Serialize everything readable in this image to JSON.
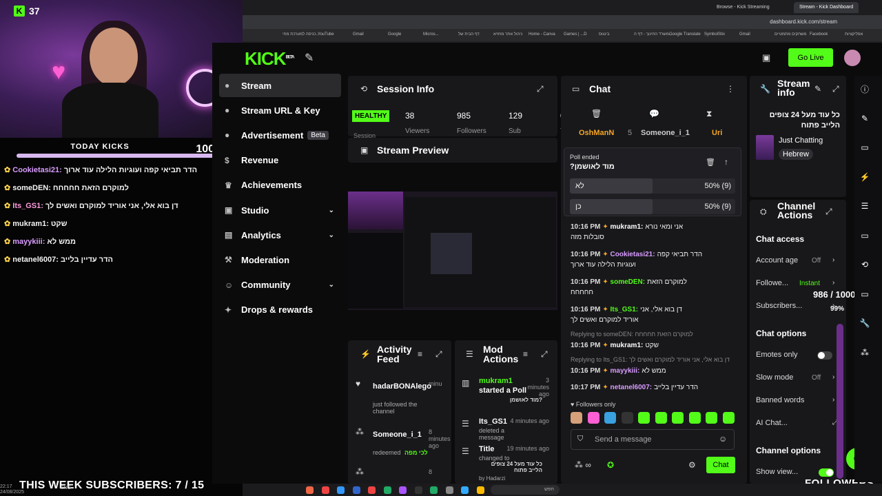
{
  "overlay": {
    "kick_count": "37",
    "today_kicks_label": "TODAY KICKS",
    "today_kicks_value": "1000",
    "today_kicks_progress": 0.98,
    "messages": [
      {
        "user": "Cookietasi21:",
        "text": "הדר תביאי קפה ועוגיות הלילה עוד ארוך",
        "color": "#d99cff"
      },
      {
        "user": "someDEN:",
        "text": "למוקרם הזאת חחחחח",
        "color": "#f4f4f4"
      },
      {
        "user": "Its_GS1:",
        "text": "דן בוא אלי, אני אוריד למוקרם ואשים לך",
        "color": "#ff9be0"
      },
      {
        "user": "mukram1:",
        "text": "שקט",
        "color": "#f4f4f4"
      },
      {
        "user": "mayykiii:",
        "text": "ממש לא",
        "color": "#d99cff"
      },
      {
        "user": "netanel6007:",
        "text": "הדר עדיין בלייב",
        "color": "#f4f4f4"
      }
    ],
    "week_subs": "THIS WEEK SUBSCRIBERS: 7 / 15",
    "followers_label": "FOLLOWERS",
    "clock_time": "22:17",
    "clock_date": "24/08/2025",
    "clock_lang": "ENG"
  },
  "browser": {
    "tabs": [
      "Browse - Kick Streaming",
      "Stream - Kick Dashboard"
    ],
    "url": "dashboard.kick.com/stream",
    "bookmarks": [
      "כניסה למערכת מחי...",
      "YouTube",
      "Gmail",
      "Google",
      "Micros...",
      "דף הבית של",
      "ניהול אתר מחזיא",
      "Home - Canva",
      "Games | ...D",
      "בינגוס",
      "משרד החינוך - דף ה...",
      "Google Translate",
      "SymbolStix",
      "Gmail",
      "משחקים מתמטיים",
      "Facebook",
      "אפליקציות"
    ]
  },
  "nav": {
    "items": [
      {
        "label": "Stream",
        "icon": "●",
        "chev": ""
      },
      {
        "label": "Stream URL & Key",
        "icon": "●",
        "chev": ""
      },
      {
        "label": "Advertisement",
        "icon": "●",
        "chev": "",
        "badge": "Beta"
      },
      {
        "label": "Revenue",
        "icon": "$",
        "chev": ""
      },
      {
        "label": "Achievements",
        "icon": "♛",
        "chev": ""
      },
      {
        "label": "Studio",
        "icon": "▣",
        "chev": "⌄"
      },
      {
        "label": "Analytics",
        "icon": "▤",
        "chev": "⌄"
      },
      {
        "label": "Moderation",
        "icon": "⚒",
        "chev": ""
      },
      {
        "label": "Community",
        "icon": "☺",
        "chev": "⌄"
      },
      {
        "label": "Drops & rewards",
        "icon": "✦",
        "chev": ""
      }
    ]
  },
  "session": {
    "title": "Session Info",
    "status": "HEALTHY",
    "status_sub": "Session",
    "stats": [
      {
        "value": "38",
        "label": "Viewers"
      },
      {
        "value": "985",
        "label": "Followers"
      },
      {
        "value": "129",
        "label": "Sub"
      },
      {
        "value": "05:4",
        "label": "Tim"
      }
    ]
  },
  "preview": {
    "title": "Stream Preview"
  },
  "activity": {
    "title": "Activity Feed",
    "items": [
      {
        "user": "hadarBONAlego",
        "desc": "just followed the channel",
        "time": "minu"
      },
      {
        "user": "Someone_i_1",
        "desc": "redeemed",
        "extra": "לכי מפה",
        "time": "8 minutes ago"
      },
      {
        "user": "",
        "desc": "",
        "time": "8"
      }
    ]
  },
  "mod": {
    "title": "Mod Actions",
    "items": [
      {
        "user": "mukram1",
        "action": "started a Poll",
        "extra": "?מוד לאושמן",
        "time": "3 minutes ago"
      },
      {
        "user": "Its_GS1",
        "action": "deleted a message",
        "time": "4 minutes ago"
      },
      {
        "user": "Title",
        "action": "changed to",
        "extra": "כל עוד מעל 24 צופים הלייב פתוח",
        "by": "by Hadarzi",
        "time": "19 minutes ago"
      }
    ]
  },
  "chat": {
    "title": "Chat",
    "pinned": [
      "OshManN",
      "Someone_i_1",
      "Uri"
    ],
    "pinned_extra": "5",
    "poll": {
      "status": "Poll ended",
      "question": "?מוד לאושמן",
      "options": [
        {
          "label": "לא",
          "pct": "50% (9)",
          "value": 0.5
        },
        {
          "label": "כן",
          "pct": "50% (9)",
          "value": 0.5
        }
      ]
    },
    "messages": [
      {
        "time": "10:16 PM",
        "user": "mukram1:",
        "text": "אני ומאי נורא",
        "cont": "סובלות מזה",
        "color": "#ffffff"
      },
      {
        "time": "10:16 PM",
        "user": "Cookietasi21:",
        "text": "הדר תביאי קפה",
        "cont": "ועוגיות הלילה עוד ארוך",
        "color": "#d99cff"
      },
      {
        "time": "10:16 PM",
        "user": "someDEN:",
        "text": "למוקרם הזאת",
        "cont": "חחחחח",
        "color": "#53fc18"
      },
      {
        "time": "10:16 PM",
        "user": "Its_GS1:",
        "text": "דן בוא אלי, אני",
        "cont": "אוריד למוקרם ואשים לך",
        "color": "#53fc18"
      },
      {
        "time": "10:16 PM",
        "user": "mukram1:",
        "text": "שקט",
        "cont": "",
        "color": "#ffffff",
        "reply": "Replying to someDEN: למוקרם הזאת חחחחח"
      },
      {
        "time": "10:16 PM",
        "user": "mayykiii:",
        "text": "ממש לא",
        "cont": "",
        "color": "#d99cff",
        "reply": "Replying to Its_GS1: דן בוא אלי, אני אוריד למוקרם ואשים לך"
      },
      {
        "time": "10:17 PM",
        "user": "netanel6007:",
        "text": "הדר עדיין בלייב",
        "cont": "",
        "color": "#d99cff"
      }
    ],
    "followers_only": "Followers only",
    "send_placeholder": "Send a message",
    "send_button": "Chat"
  },
  "stream_info": {
    "title_line1": "Stream",
    "title_line2": "info",
    "stream_title": "כל עוד מעל 24 צופים הלייב פתוח",
    "category": "Just Chatting",
    "language": "Hebrew"
  },
  "channel_actions": {
    "title_line1": "Channel",
    "title_line2": "Actions",
    "chat_access": "Chat access",
    "rows": [
      {
        "label": "Account age",
        "value": "Off"
      },
      {
        "label": "Followe...",
        "value": "Instant"
      },
      {
        "label": "Subscribers...",
        "value": ""
      }
    ],
    "chat_options": "Chat options",
    "options": [
      {
        "label": "Emotes only",
        "value": ""
      },
      {
        "label": "Slow mode",
        "value": "Off"
      },
      {
        "label": "Banned words",
        "value": ""
      },
      {
        "label": "AI Chat...",
        "value": ""
      }
    ],
    "channel_options": "Channel options",
    "show_view": "Show view..."
  },
  "header": {
    "go_live": "Go Live"
  },
  "goal": {
    "text": "986 / 1000",
    "pct": "99%"
  },
  "colors": {
    "brand": "#53fc18",
    "panel": "#18181b",
    "bg": "#0b0b0c"
  }
}
